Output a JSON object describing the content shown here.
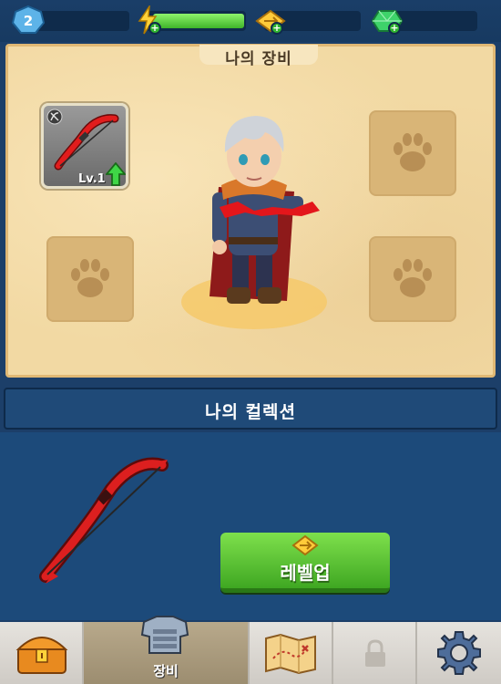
{
  "topbar": {
    "level": "2",
    "energy_fill": 1.0,
    "icons": [
      "level-badge-icon",
      "lightning-icon",
      "gold-ticket-icon",
      "gem-icon"
    ]
  },
  "equipment": {
    "title": "나의 장비",
    "weapon_slot": {
      "level_label": "Lv.1",
      "icon": "bow-icon"
    },
    "empty_slot_icon": "paw-icon"
  },
  "collection": {
    "title": "나의 컬렉션",
    "levelup_label": "레벨업"
  },
  "bottom_nav": {
    "items": [
      {
        "icon": "treasure-chest-icon",
        "label": ""
      },
      {
        "icon": "armor-icon",
        "label": "장비",
        "active": true
      },
      {
        "icon": "map-icon",
        "label": ""
      },
      {
        "icon": "lock-icon",
        "label": ""
      },
      {
        "icon": "gear-icon",
        "label": ""
      }
    ]
  },
  "colors": {
    "background": "#1c3f69",
    "panel": "#f2d9a3",
    "energy": "#56c838",
    "levelup": "#4fbd2c",
    "bow_red": "#d81c1c"
  }
}
